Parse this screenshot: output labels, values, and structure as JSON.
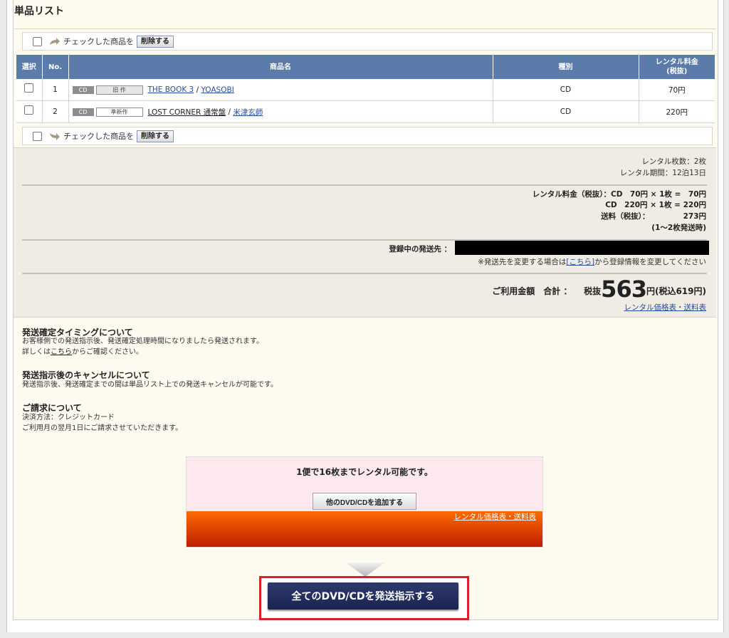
{
  "section_title": "単品リスト",
  "bulk_action": {
    "label": "チェックした商品を",
    "delete_button": "削除する"
  },
  "table": {
    "headers": {
      "select": "選択",
      "no": "No.",
      "name": "商品名",
      "type": "種別",
      "fee_line1": "レンタル料金",
      "fee_line2": "(税抜)"
    },
    "rows": [
      {
        "no": "1",
        "media": "CD",
        "status": "旧 作",
        "title": "THE BOOK 3",
        "artist": "YOASOBI",
        "type": "CD",
        "fee": "70円"
      },
      {
        "no": "2",
        "media": "CD",
        "status": "準新作",
        "title": "LOST CORNER 通常盤",
        "artist": "米津玄師",
        "type": "CD",
        "fee": "220円"
      }
    ]
  },
  "summary": {
    "count": "レンタル枚数：2枚",
    "period": "レンタル期間：12泊13日",
    "fee_line1": "レンタル料金（税抜）：CD　70円 × 1枚 =　70円",
    "fee_line2": "CD　220円 × 1枚 = 220円",
    "shipping_line": "送料（税抜）：　　　　　273円",
    "shipping_note": "(1〜2枚発送時)",
    "address_label": "登録中の発送先 ：",
    "address_note_pre": "※発送先を変更する場合は",
    "address_link": "[こちら]",
    "address_note_post": "から登録情報を変更してください",
    "total_label": "ご利用金額　合計 ：",
    "tax_ex": "税抜",
    "total_amount": "563",
    "total_suffix": "円(税込619円)",
    "price_link": "レンタル価格表・送料表"
  },
  "info": {
    "timing_title": "発送確定タイミングについて",
    "timing_text1": "お客様側での発送指示後、発送確定処理時間になりましたら発送されます。",
    "timing_text2_pre": "詳しくは",
    "timing_text2_link": "こちら",
    "timing_text2_post": "からご確認ください。",
    "cancel_title": "発送指示後のキャンセルについて",
    "cancel_text": "発送指示後、発送確定までの間は単品リスト上での発送キャンセルが可能です。",
    "billing_title": "ご請求について",
    "billing_text1": "決済方法：クレジットカード",
    "billing_text2": "ご利用月の翌月1日にご請求させていただきます。"
  },
  "promo": {
    "message": "1便で16枚までレンタル可能です。",
    "add_button": "他のDVD/CDを追加する",
    "price_link": "レンタル価格表・送料表"
  },
  "cta": {
    "label": "全てのDVD/CDを発送指示する"
  },
  "colors": {
    "header_blue": "#5b7bab",
    "cta_navy": "#1f2a5c",
    "highlight_red": "#d8202a",
    "promo_orange": "#ff6a00"
  }
}
